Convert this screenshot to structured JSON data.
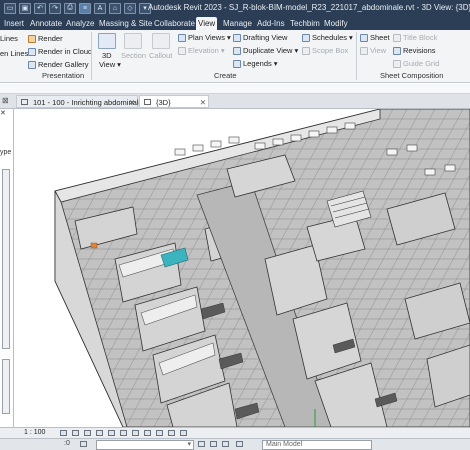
{
  "app": {
    "title": "Autodesk Revit 2023 - SJ_R-blok-BIM-model_R23_221017_abdominale.rvt - 3D View: {3D}"
  },
  "ribbon_tabs": [
    "Insert",
    "Annotate",
    "Analyze",
    "Massing & Site",
    "Collaborate",
    "View",
    "Manage",
    "Add-Ins",
    "Techbim",
    "Modify"
  ],
  "active_tab": "View",
  "ribbon": {
    "presentation": {
      "thin_lines": "Lines",
      "hidden_lines": "en Lines",
      "render": "Render",
      "render_cloud": "Render in Cloud",
      "render_gallery": "Render Gallery",
      "label": "Presentation"
    },
    "create": {
      "view3d_line1": "3D",
      "view3d_line2": "View",
      "section": "Section",
      "callout": "Callout",
      "plan_views": "Plan Views",
      "elevation": "Elevation",
      "legends": "Legends",
      "drafting_view": "Drafting View",
      "duplicate_view": "Duplicate View",
      "schedules": "Schedules",
      "scope_box": "Scope Box",
      "label": "Create"
    },
    "sheet_composition": {
      "sheet": "Sheet",
      "title_block": "Title Block",
      "view": "View",
      "revisions": "Revisions",
      "guide_grid": "Guide Grid",
      "label": "Sheet Composition"
    }
  },
  "doc_tabs": [
    {
      "label": "101 - 100 - Inrichting abdominale"
    },
    {
      "label": "{3D}"
    }
  ],
  "left_palette": {
    "label_top": "Lines",
    "label_type": "ype"
  },
  "view_bar": {
    "scale": "1 : 100"
  },
  "status_bar": {
    "coords": ":0",
    "model": "Main Model"
  },
  "colors": {
    "titlebar": "#2c3e55",
    "ribbon": "#f3f4f6",
    "accent_cyan": "#3bb4c0",
    "floor_grey": "#bdbdbd"
  }
}
